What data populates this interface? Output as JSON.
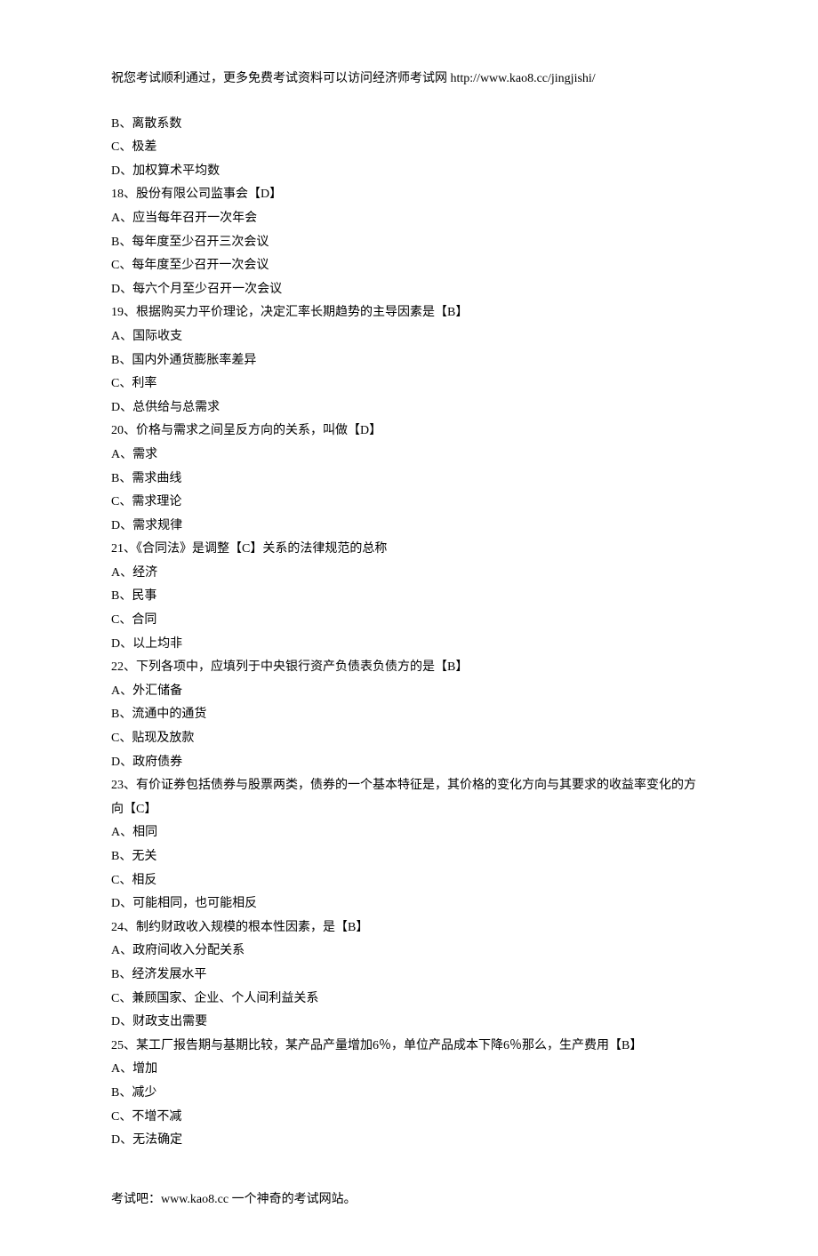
{
  "header": "祝您考试顺利通过，更多免费考试资料可以访问经济师考试网 http://www.kao8.cc/jingjishi/",
  "lines": [
    "B、离散系数",
    "C、极差",
    "D、加权算术平均数",
    "18、股份有限公司监事会【D】",
    "A、应当每年召开一次年会",
    "B、每年度至少召开三次会议",
    "C、每年度至少召开一次会议",
    "D、每六个月至少召开一次会议",
    "19、根据购买力平价理论，决定汇率长期趋势的主导因素是【B】",
    "A、国际收支",
    "B、国内外通货膨胀率差异",
    "C、利率",
    "D、总供给与总需求",
    "20、价格与需求之间呈反方向的关系，叫做【D】",
    "A、需求",
    "B、需求曲线",
    "C、需求理论",
    "D、需求规律",
    "21、《合同法》是调整【C】关系的法律规范的总称",
    "A、经济",
    "B、民事",
    "C、合同",
    "D、以上均非",
    "22、下列各项中，应填列于中央银行资产负债表负债方的是【B】",
    "A、外汇储备",
    "B、流通中的通货",
    "C、贴现及放款",
    "D、政府债券",
    "23、有价证券包括债券与股票两类，债券的一个基本特征是，其价格的变化方向与其要求的收益率变化的方向【C】",
    "A、相同",
    "B、无关",
    "C、相反",
    "D、可能相同，也可能相反",
    "24、制约财政收入规模的根本性因素，是【B】",
    "A、政府间收入分配关系",
    "B、经济发展水平",
    "C、兼顾国家、企业、个人间利益关系",
    "D、财政支出需要",
    "25、某工厂报告期与基期比较，某产品产量增加6％，单位产品成本下降6％那么，生产费用【B】",
    "A、增加",
    "B、减少",
    "C、不增不减",
    "D、无法确定"
  ],
  "footer": "考试吧：www.kao8.cc 一个神奇的考试网站。"
}
